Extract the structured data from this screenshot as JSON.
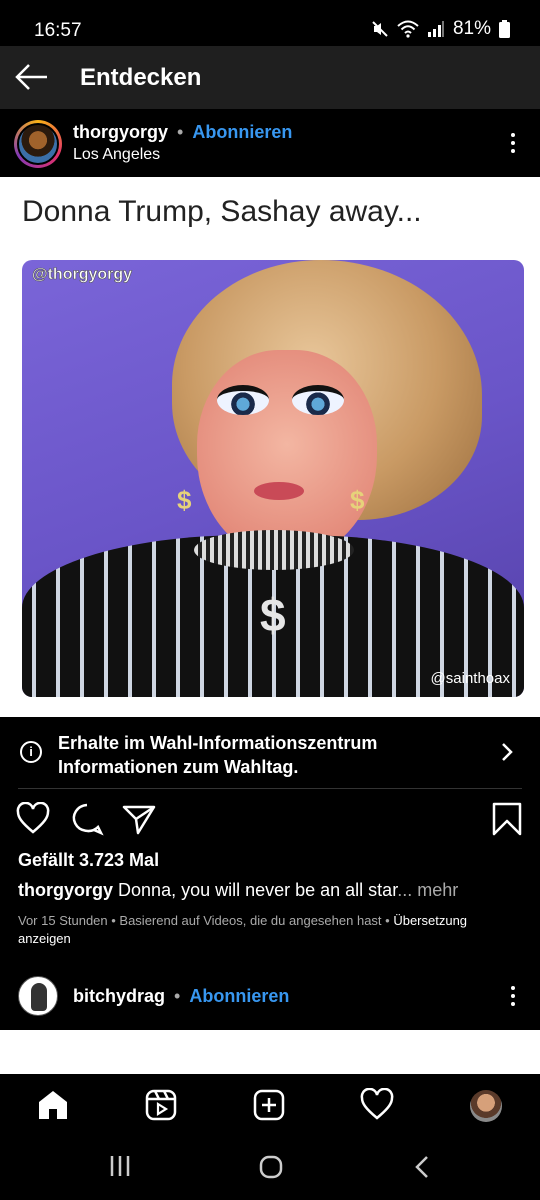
{
  "status_bar": {
    "time": "16:57",
    "battery": "81%"
  },
  "header": {
    "title": "Entdecken"
  },
  "post": {
    "username": "thorgyorgy",
    "separator": "•",
    "follow_label": "Abonnieren",
    "location": "Los Angeles",
    "image_title": "Donna Trump, Sashay away...",
    "watermark_top": "@thorgyorgy",
    "watermark_bottom": "@sainthoax",
    "likes": "Gefällt 3.723 Mal",
    "caption_user": "thorgyorgy",
    "caption_text": "Donna, you will never be an all star",
    "caption_more": "... mehr",
    "meta": "Vor 15 Stunden • Basierend auf Videos, die du angesehen hast •",
    "meta_link": "Übersetzung anzeigen"
  },
  "info_banner": {
    "text": "Erhalte im Wahl-Informationszentrum Informationen zum Wahltag."
  },
  "next_post": {
    "username": "bitchydrag",
    "separator": "•",
    "follow_label": "Abonnieren"
  },
  "icons": {
    "back": "back-arrow-icon",
    "menu": "more-vertical-icon",
    "info": "info-icon",
    "chevron": "chevron-right-icon",
    "like": "heart-icon",
    "comment": "comment-icon",
    "share": "send-icon",
    "save": "bookmark-icon",
    "home": "home-icon",
    "reels": "reels-icon",
    "create": "plus-square-icon",
    "activity": "heart-icon",
    "profile": "profile-avatar"
  },
  "colors": {
    "accent": "#3897f0",
    "background": "#000000"
  }
}
